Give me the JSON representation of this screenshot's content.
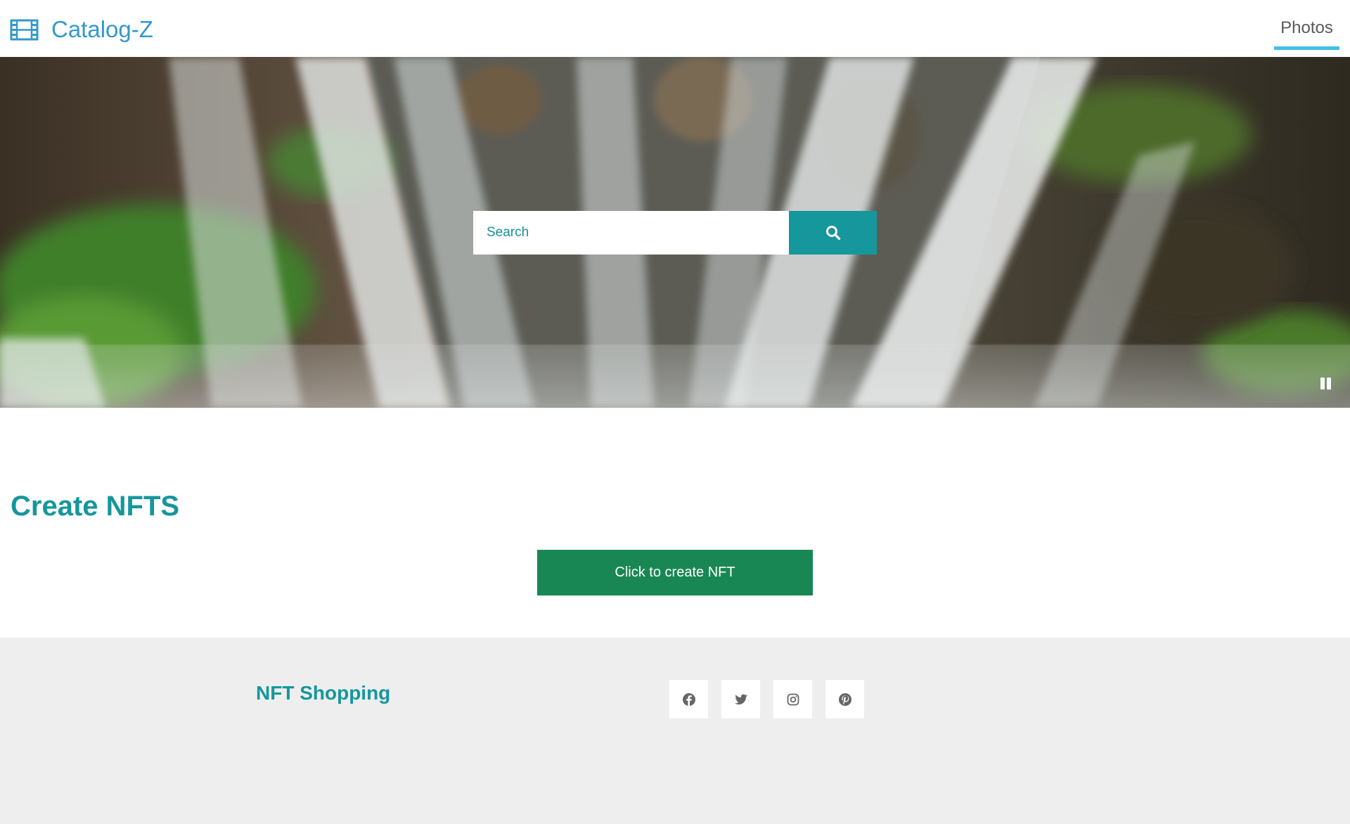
{
  "navbar": {
    "brand": "Catalog-Z",
    "brand_icon": "film-icon",
    "links": [
      {
        "label": "Photos",
        "active": true
      }
    ]
  },
  "hero": {
    "background": "waterfall video",
    "search": {
      "placeholder": "Search",
      "value": "",
      "button_icon": "search-icon"
    },
    "video_control_icon": "pause-icon"
  },
  "main": {
    "title": "Create NFTS",
    "button_label": "Click to create NFT"
  },
  "footer": {
    "title": "NFT Shopping",
    "social": [
      {
        "icon": "facebook-icon"
      },
      {
        "icon": "twitter-icon"
      },
      {
        "icon": "instagram-icon"
      },
      {
        "icon": "pinterest-icon"
      }
    ]
  },
  "colors": {
    "brand": "#3399cc",
    "accent": "#15979c",
    "nav_underline": "#3fbfea",
    "create_button": "#198754",
    "footer_background": "#eeeeee",
    "social_icon": "#666666"
  }
}
